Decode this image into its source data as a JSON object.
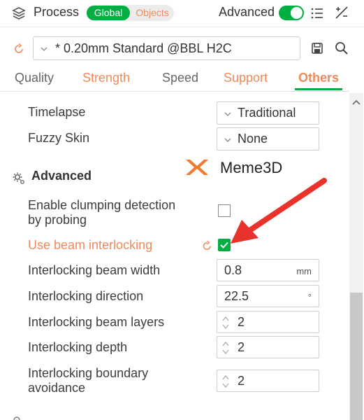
{
  "header": {
    "title": "Process",
    "toggle": {
      "global_label": "Global",
      "objects_label": "Objects",
      "selected": "Global"
    },
    "advanced_label": "Advanced",
    "advanced_on": true
  },
  "preset": {
    "value": "* 0.20mm Standard @BBL H2C"
  },
  "tabs": [
    {
      "label": "Quality",
      "state": "normal"
    },
    {
      "label": "Strength",
      "state": "modified"
    },
    {
      "label": "Speed",
      "state": "normal"
    },
    {
      "label": "Support",
      "state": "modified"
    },
    {
      "label": "Others",
      "state": "active"
    }
  ],
  "settings": {
    "timelapse": {
      "label": "Timelapse",
      "value": "Traditional"
    },
    "fuzzy_skin": {
      "label": "Fuzzy Skin",
      "value": "None"
    },
    "advanced_section": {
      "title": "Advanced"
    },
    "clumping": {
      "label_line1": "Enable clumping detection",
      "label_line2": "by probing",
      "checked": false
    },
    "beam_interlocking": {
      "label": "Use beam interlocking",
      "checked": true
    },
    "beam_width": {
      "label": "Interlocking beam width",
      "value": "0.8",
      "unit": "mm"
    },
    "direction": {
      "label": "Interlocking direction",
      "value": "22.5",
      "unit": "°"
    },
    "beam_layers": {
      "label": "Interlocking beam layers",
      "value": "2"
    },
    "depth": {
      "label": "Interlocking depth",
      "value": "2"
    },
    "boundary": {
      "label_line1": "Interlocking boundary",
      "label_line2": "avoidance",
      "value": "2"
    }
  },
  "watermark": {
    "text": "Meme3D"
  },
  "colors": {
    "accent_green": "#00ae42",
    "modified_orange": "#ef8a5c",
    "arrow_red": "#e8322b"
  }
}
